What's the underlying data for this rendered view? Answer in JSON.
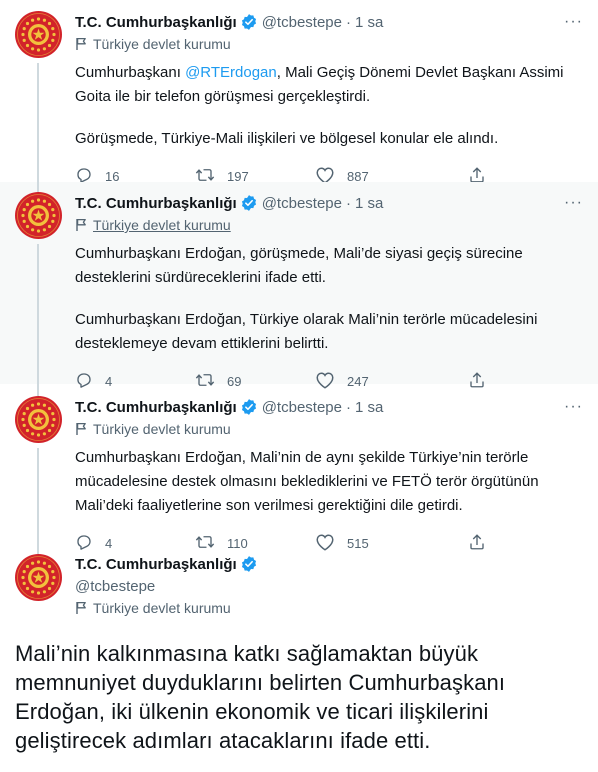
{
  "account": {
    "name": "T.C. Cumhurbaşkanlığı",
    "handle": "@tcbestepe",
    "label": "Türkiye devlet kurumu"
  },
  "tweets": [
    {
      "time": "1 sa",
      "paragraphs": [
        {
          "prefix": "Cumhurbaşkanı ",
          "mention": "@RTErdogan",
          "suffix": ", Mali Geçiş Dönemi Devlet Başkanı Assimi Goita ile bir telefon görüşmesi gerçekleştirdi."
        },
        {
          "prefix": "Görüşmede, Türkiye-Mali ilişkileri ve bölgesel konular ele alındı."
        }
      ],
      "replies": "16",
      "retweets": "197",
      "likes": "887"
    },
    {
      "time": "1 sa",
      "paragraphs": [
        {
          "prefix": "Cumhurbaşkanı Erdoğan, görüşmede, Mali’de siyasi geçiş sürecine desteklerini sürdüreceklerini ifade etti."
        },
        {
          "prefix": "Cumhurbaşkanı Erdoğan, Türkiye olarak Mali’nin terörle mücadelesini desteklemeye devam ettiklerini belirtti."
        }
      ],
      "replies": "4",
      "retweets": "69",
      "likes": "247"
    },
    {
      "time": "1 sa",
      "paragraphs": [
        {
          "prefix": "Cumhurbaşkanı Erdoğan, Mali’nin de aynı şekilde Türkiye’nin terörle mücadelesine destek olmasını beklediklerini ve FETÖ terör örgütünün Mali’deki faaliyetlerine son verilmesi gerektiğini dile getirdi."
        }
      ],
      "replies": "4",
      "retweets": "110",
      "likes": "515"
    }
  ],
  "main_tweet": {
    "text": "Mali’nin kalkınmasına katkı sağlamaktan büyük memnuniyet duyduklarını belirten Cumhurbaşkanı Erdoğan, iki ülkenin ekonomik ve ticari ilişkilerini geliştirecek adımları atacaklarını ifade etti."
  },
  "colors": {
    "accent": "#1d9bf0",
    "avatar": "#d2232a",
    "muted": "#536471",
    "hover_bg": "#f7f9f9"
  },
  "icons": [
    "verified-badge-icon",
    "flag-icon",
    "more-icon",
    "reply-icon",
    "retweet-icon",
    "like-icon",
    "share-icon",
    "presidential-seal-icon"
  ]
}
